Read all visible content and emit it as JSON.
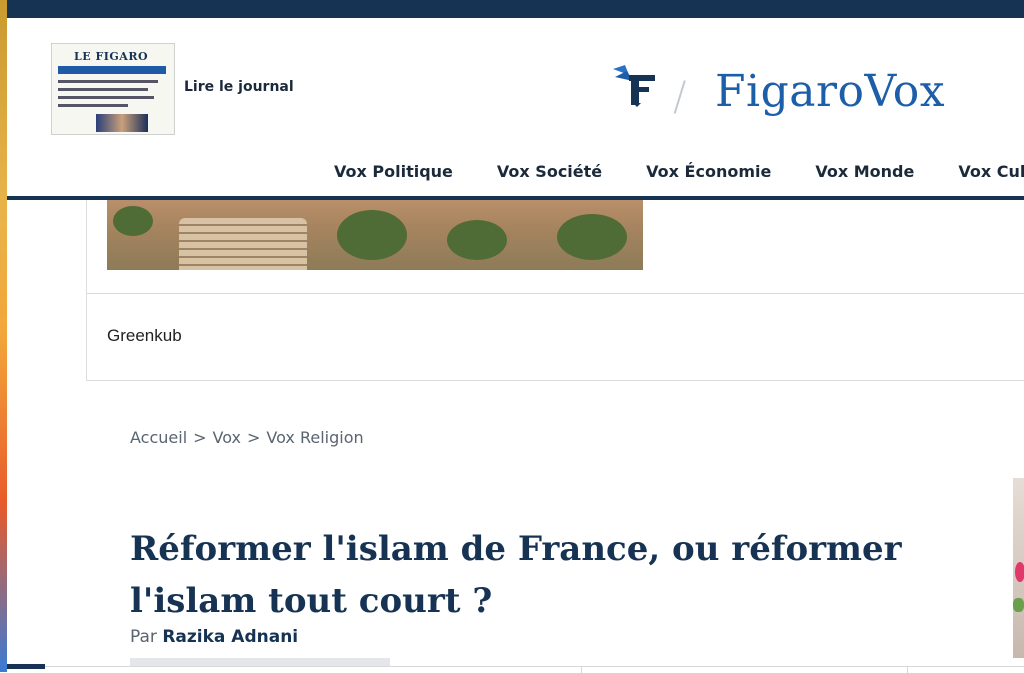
{
  "header": {
    "newspaper_thumbnail": {
      "masthead": "LE FIGARO",
      "headline": "Hausses d'impôts: Macron résistera-t-il aux pressions?"
    },
    "read_paper_link": "Lire le journal",
    "brand": "FigaroVox"
  },
  "nav": {
    "items": [
      {
        "label": "Vox Politique"
      },
      {
        "label": "Vox Société"
      },
      {
        "label": "Vox Économie"
      },
      {
        "label": "Vox Monde"
      },
      {
        "label": "Vox Culture"
      }
    ]
  },
  "ad": {
    "sponsor": "Greenkub"
  },
  "breadcrumb": {
    "items": [
      "Accueil",
      "Vox",
      "Vox Religion"
    ],
    "separator": ">"
  },
  "article": {
    "title": "Réformer l'islam de France, ou réformer l'islam tout court ?",
    "byline_prefix": "Par",
    "author": "Razika Adnani"
  },
  "colors": {
    "navy": "#163354",
    "brand_blue": "#1c5ea8",
    "text_gray": "#5a6470"
  }
}
